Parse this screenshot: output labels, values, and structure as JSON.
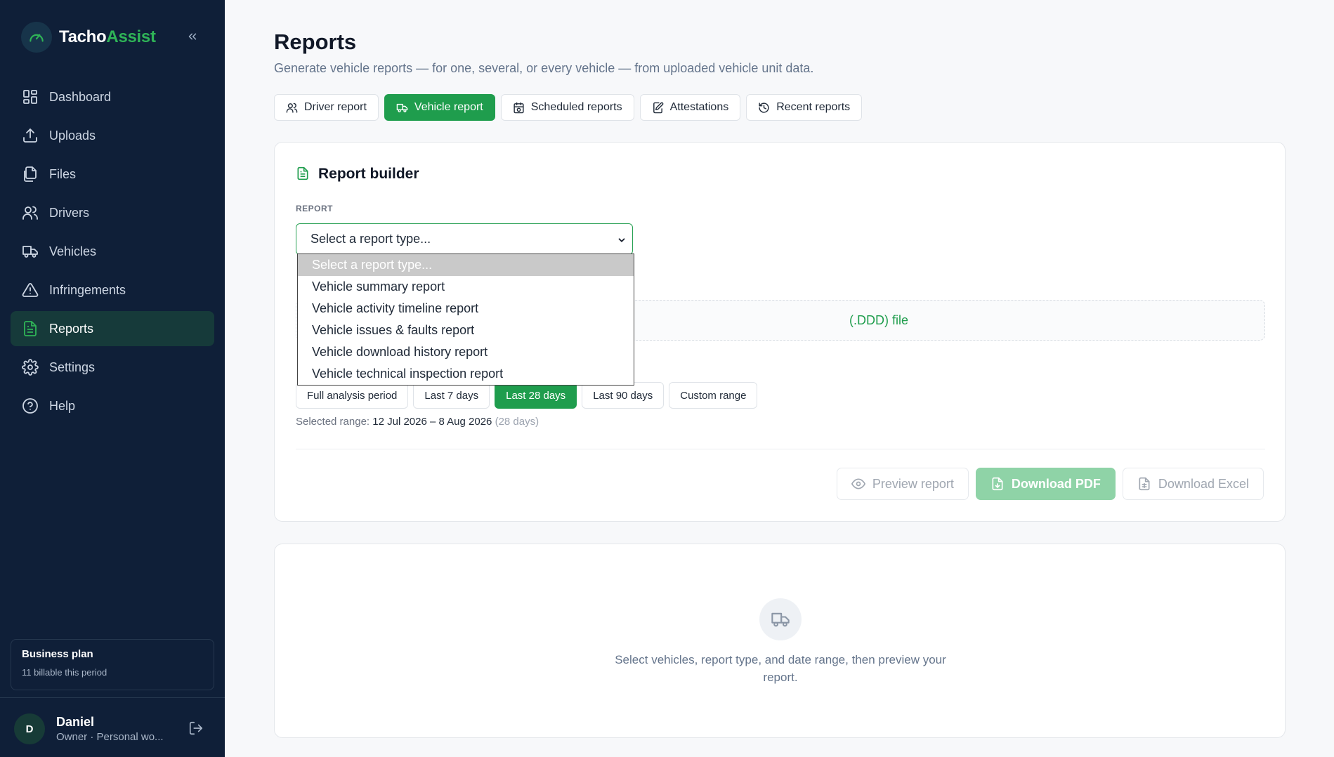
{
  "app": {
    "brand_part1": "Tacho",
    "brand_part2": "Assist"
  },
  "sidebar": {
    "items": [
      {
        "label": "Dashboard",
        "icon": "dashboard-icon"
      },
      {
        "label": "Uploads",
        "icon": "upload-icon"
      },
      {
        "label": "Files",
        "icon": "files-icon"
      },
      {
        "label": "Drivers",
        "icon": "drivers-icon"
      },
      {
        "label": "Vehicles",
        "icon": "truck-icon"
      },
      {
        "label": "Infringements",
        "icon": "warning-icon"
      },
      {
        "label": "Reports",
        "icon": "report-icon",
        "active": true
      },
      {
        "label": "Settings",
        "icon": "gear-icon"
      },
      {
        "label": "Help",
        "icon": "help-icon"
      }
    ],
    "plan": {
      "title": "Business plan",
      "subtitle": "11 billable this period"
    },
    "user": {
      "initial": "D",
      "name": "Daniel",
      "role": "Owner · Personal wo..."
    }
  },
  "header": {
    "title": "Reports",
    "subtitle": "Generate vehicle reports — for one, several, or every vehicle — from uploaded vehicle unit data."
  },
  "tabs": [
    {
      "label": "Driver report",
      "icon": "users-icon"
    },
    {
      "label": "Vehicle report",
      "icon": "truck-icon",
      "active": true
    },
    {
      "label": "Scheduled reports",
      "icon": "calendar-clock-icon"
    },
    {
      "label": "Attestations",
      "icon": "edit-document-icon"
    },
    {
      "label": "Recent reports",
      "icon": "history-icon"
    }
  ],
  "builder": {
    "title": "Report builder",
    "report_label": "REPORT",
    "select_value": "Select a report type...",
    "dropdown_options": [
      "Select a report type...",
      "Vehicle summary report",
      "Vehicle activity timeline report",
      "Vehicle issues & faults report",
      "Vehicle download history report",
      "Vehicle technical inspection report"
    ],
    "dropzone_text": "(.DDD) file",
    "ranges": [
      "Full analysis period",
      "Last 7 days",
      "Last 28 days",
      "Last 90 days",
      "Custom range"
    ],
    "active_range": "Last 28 days",
    "selected_range_label": "Selected range:",
    "selected_range_value": "12 Jul 2026 – 8 Aug 2026",
    "selected_range_days": "(28 days)",
    "actions": {
      "preview": "Preview report",
      "pdf": "Download PDF",
      "excel": "Download Excel"
    }
  },
  "empty_state": {
    "text": "Select vehicles, report type, and date range, then preview your report."
  },
  "colors": {
    "sidebar_bg": "#0f1f38",
    "accent": "#1f9d4d",
    "brand_green": "#2fb457"
  }
}
